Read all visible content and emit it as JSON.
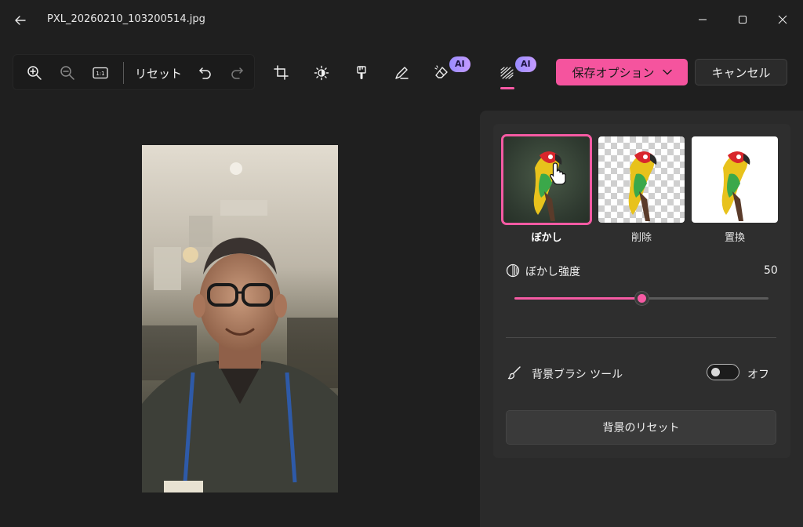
{
  "window": {
    "title": "PXL_20260210_103200514.jpg"
  },
  "toolbar": {
    "reset_label": "リセット",
    "ai_badge_1": "AI",
    "ai_badge_2": "AI",
    "save_label": "保存オプション",
    "cancel_label": "キャンセル"
  },
  "icons": {
    "back": "arrow-left-icon",
    "minimize": "minimize-icon",
    "maximize": "maximize-icon",
    "close": "close-icon",
    "zoom_in": "zoom-in-icon",
    "zoom_out": "zoom-out-icon",
    "actual_size": "actual-size-icon",
    "undo": "undo-icon",
    "redo": "redo-icon",
    "crop": "crop-icon",
    "adjust": "brightness-icon",
    "filter": "filter-brush-icon",
    "markup": "pen-icon",
    "erase": "eraser-icon",
    "background": "background-icon"
  },
  "panel": {
    "options": [
      {
        "label": "ぼかし",
        "selected": true
      },
      {
        "label": "削除",
        "selected": false
      },
      {
        "label": "置換",
        "selected": false
      }
    ],
    "blur": {
      "label": "ぼかし強度",
      "value": "50",
      "fraction": 0.5
    },
    "brush_tool": {
      "label": "背景ブラシ ツール",
      "state_label": "オフ",
      "on": false
    },
    "reset_background_label": "背景のリセット"
  },
  "colors": {
    "accent": "#f5549e",
    "background": "#1f1f1f",
    "panel": "#2a2a2a"
  }
}
